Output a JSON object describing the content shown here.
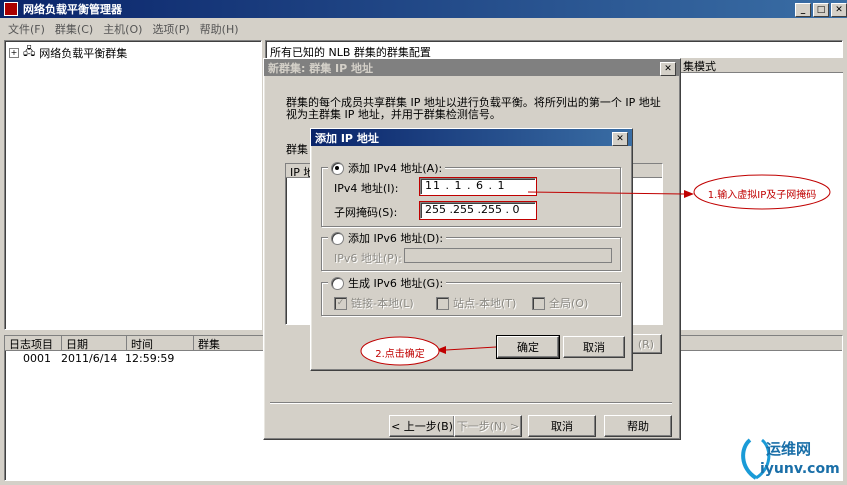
{
  "window": {
    "title": "网络负载平衡管理器"
  },
  "menu": [
    "文件(F)",
    "群集(C)",
    "主机(O)",
    "选项(P)",
    "帮助(H)"
  ],
  "tree": {
    "root_label": "网络负载平衡群集"
  },
  "right_panel": {
    "header": "所有已知的 NLB 群集的群集配置",
    "column_cluster_mode": "集模式"
  },
  "log": {
    "columns": [
      "日志项目",
      "日期",
      "时间",
      "群集"
    ],
    "rows": [
      {
        "item": "0001",
        "date": "2011/6/14",
        "time": "12:59:59",
        "cluster": ""
      }
    ]
  },
  "wizard": {
    "title": "新群集: 群集 IP 地址",
    "description_line1": "群集的每个成员共享群集 IP 地址以进行负载平衡。将所列出的第一个 IP 地址",
    "description_line2": "视为主群集 IP 地址，并用于群集检测信号。",
    "group_label": "群集",
    "list_header": "IP 地",
    "side_button": "(R)",
    "back_button": "< 上一步(B)",
    "next_button": "下一步(N) >",
    "cancel_button": "取消",
    "help_button": "帮助"
  },
  "dialog": {
    "title": "添加 IP 地址",
    "ipv4_radio": "添加 IPv4 地址(A):",
    "ipv4_label": "IPv4 地址(I):",
    "ipv4_value": "11 . 1 . 6 . 1",
    "subnet_label": "子网掩码(S):",
    "subnet_value": "255 .255 .255 . 0",
    "ipv6_radio": "添加 IPv6 地址(D):",
    "ipv6_label": "IPv6 地址(P):",
    "gen_radio": "生成 IPv6 地址(G):",
    "gen_link_local": "链接-本地(L)",
    "gen_site_local": "站点-本地(T)",
    "gen_global": "全局(O)",
    "ok_button": "确定",
    "cancel_button": "取消"
  },
  "annotations": {
    "step1": "1.输入虚拟IP及子网掩码",
    "step2": "2.点击确定"
  },
  "watermark": {
    "text1": "运维网",
    "text2": "iyunv.com"
  },
  "colors": {
    "title_active": "#0a246a",
    "title_inactive": "#808080",
    "annotation_red": "#c00000"
  }
}
